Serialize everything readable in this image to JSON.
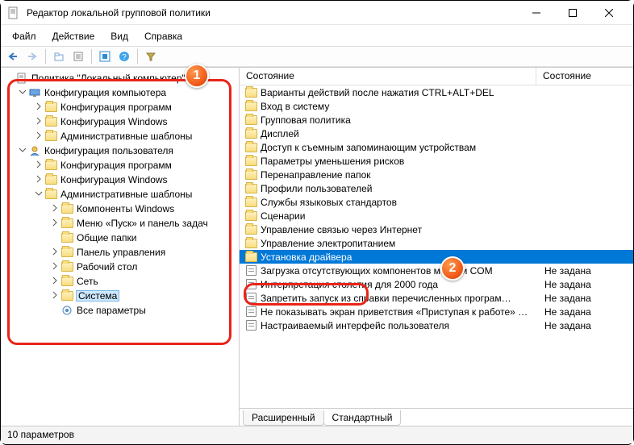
{
  "window": {
    "title": "Редактор локальной групповой политики",
    "minimize": "–",
    "maximize": "□",
    "close": "✕"
  },
  "menu": {
    "file": "Файл",
    "action": "Действие",
    "view": "Вид",
    "help": "Справка"
  },
  "tree": {
    "root": "Политика \"Локальный компьютер\"",
    "comp_cfg": "Конфигурация компьютера",
    "user_cfg": "Конфигурация пользователя",
    "cfg_programs": "Конфигурация программ",
    "cfg_windows": "Конфигурация Windows",
    "admin_templates": "Административные шаблоны",
    "comp_windows": "Компоненты Windows",
    "start_menu": "Меню «Пуск» и панель задач",
    "shared_folders": "Общие папки",
    "control_panel": "Панель управления",
    "desktop": "Рабочий стол",
    "network": "Сеть",
    "system": "Система",
    "all_params": "Все параметры"
  },
  "list": {
    "header_state_left": "Состояние",
    "header_state_right": "Состояние",
    "not_set": "Не задана",
    "items": [
      {
        "name": "Варианты действий после нажатия CTRL+ALT+DEL",
        "icon": "folder",
        "state": ""
      },
      {
        "name": "Вход в систему",
        "icon": "folder",
        "state": ""
      },
      {
        "name": "Групповая политика",
        "icon": "folder",
        "state": ""
      },
      {
        "name": "Дисплей",
        "icon": "folder",
        "state": ""
      },
      {
        "name": "Доступ к съемным запоминающим устройствам",
        "icon": "folder",
        "state": ""
      },
      {
        "name": "Параметры уменьшения рисков",
        "icon": "folder",
        "state": ""
      },
      {
        "name": "Перенаправление папок",
        "icon": "folder",
        "state": ""
      },
      {
        "name": "Профили пользователей",
        "icon": "folder",
        "state": ""
      },
      {
        "name": "Службы языковых стандартов",
        "icon": "folder",
        "state": ""
      },
      {
        "name": "Сценарии",
        "icon": "folder",
        "state": ""
      },
      {
        "name": "Управление связью через Интернет",
        "icon": "folder",
        "state": ""
      },
      {
        "name": "Управление электропитанием",
        "icon": "folder",
        "state": ""
      },
      {
        "name": "Установка драйвера",
        "icon": "folder",
        "state": "",
        "selected": true
      },
      {
        "name": "Загрузка отсутствующих компонентов модели COM",
        "icon": "setting",
        "state": "Не задана"
      },
      {
        "name": "Интерпретация столетия для 2000 года",
        "icon": "setting",
        "state": "Не задана"
      },
      {
        "name": "Запретить запуск из справки перечисленных програм…",
        "icon": "setting",
        "state": "Не задана"
      },
      {
        "name": "Не показывать экран приветствия «Приступая к работе» …",
        "icon": "setting",
        "state": "Не задана"
      },
      {
        "name": "Настраиваемый интерфейс пользователя",
        "icon": "setting",
        "state": "Не задана"
      }
    ]
  },
  "tabs": {
    "extended": "Расширенный",
    "standard": "Стандартный"
  },
  "status": {
    "text": "10 параметров"
  },
  "anno": {
    "b1": "1",
    "b2": "2"
  }
}
